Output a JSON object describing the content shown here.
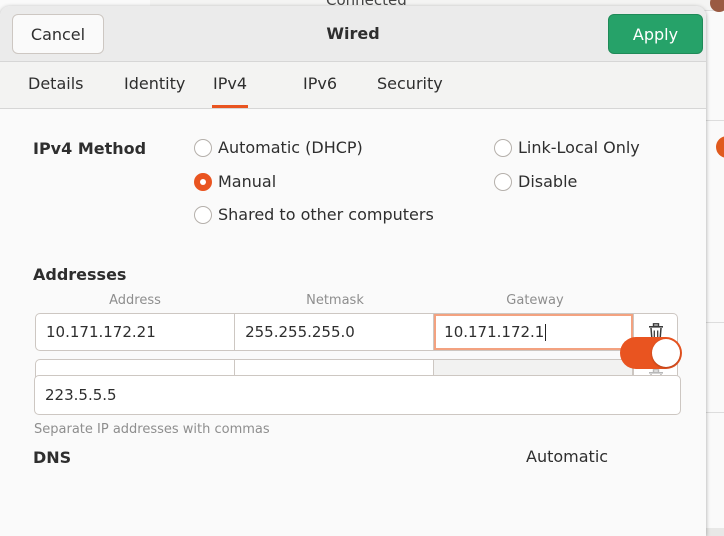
{
  "background": {
    "partial_text": "Connected"
  },
  "header": {
    "cancel_label": "Cancel",
    "title": "Wired",
    "apply_label": "Apply"
  },
  "tabs": [
    {
      "label": "Details"
    },
    {
      "label": "Identity"
    },
    {
      "label": "IPv4",
      "active": true
    },
    {
      "label": "IPv6"
    },
    {
      "label": "Security"
    }
  ],
  "ipv4_method": {
    "label": "IPv4 Method",
    "options": [
      {
        "label": "Automatic (DHCP)",
        "selected": false
      },
      {
        "label": "Manual",
        "selected": true
      },
      {
        "label": "Shared to other computers",
        "selected": false
      },
      {
        "label": "Link-Local Only",
        "selected": false
      },
      {
        "label": "Disable",
        "selected": false
      }
    ]
  },
  "addresses": {
    "label": "Addresses",
    "columns": [
      "Address",
      "Netmask",
      "Gateway"
    ],
    "rows": [
      {
        "address": "10.171.172.21",
        "netmask": "255.255.255.0",
        "gateway": "10.171.172.1"
      },
      {
        "address": "",
        "netmask": "",
        "gateway": ""
      }
    ]
  },
  "dns": {
    "label": "DNS",
    "automatic_label": "Automatic",
    "automatic_enabled": true,
    "value": "223.5.5.5",
    "hint": "Separate IP addresses with commas"
  },
  "colors": {
    "accent": "#e95420",
    "apply_green": "#26a269"
  }
}
